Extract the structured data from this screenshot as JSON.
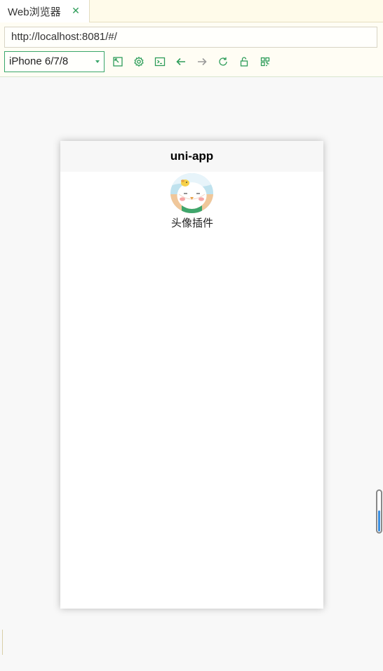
{
  "tab": {
    "title": "Web浏览器",
    "close_icon": "close-icon"
  },
  "url": {
    "value": "http://localhost:8081/#/"
  },
  "device": {
    "selected": "iPhone 6/7/8"
  },
  "toolbar": {
    "icons": [
      "resize-icon",
      "settings-icon",
      "console-icon",
      "back-arrow-icon",
      "forward-arrow-icon",
      "reload-icon",
      "lock-icon",
      "qrcode-icon"
    ],
    "accent_color": "#2e9d5a"
  },
  "app": {
    "nav_title": "uni-app",
    "items": [
      {
        "label": "头像插件",
        "icon": "avatar-image"
      }
    ]
  }
}
